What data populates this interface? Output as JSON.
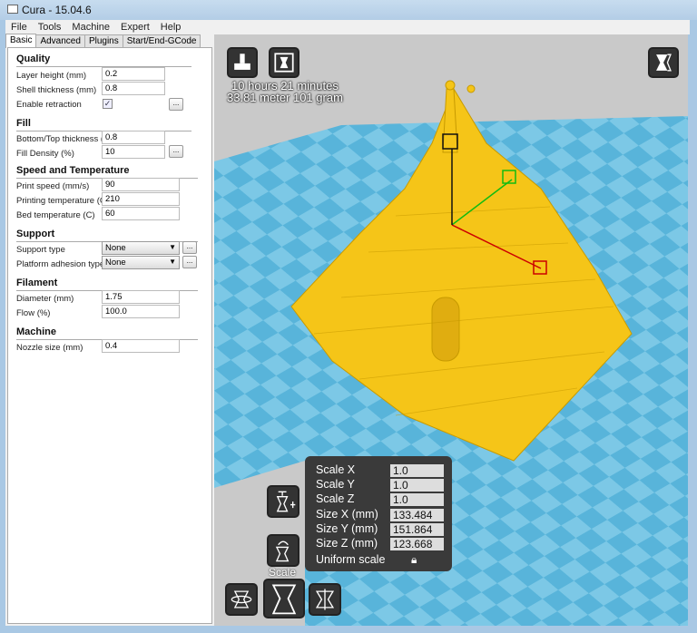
{
  "window": {
    "title": "Cura - 15.04.6"
  },
  "menu": [
    "File",
    "Tools",
    "Machine",
    "Expert",
    "Help"
  ],
  "tabs": [
    "Basic",
    "Advanced",
    "Plugins",
    "Start/End-GCode"
  ],
  "quality": {
    "title": "Quality",
    "layer_height_label": "Layer height (mm)",
    "layer_height": "0.2",
    "shell_label": "Shell thickness (mm)",
    "shell": "0.8",
    "retraction_label": "Enable retraction",
    "retraction_checked": true
  },
  "fill": {
    "title": "Fill",
    "bt_label": "Bottom/Top thickness (mm)",
    "bt": "0.8",
    "density_label": "Fill Density (%)",
    "density": "10"
  },
  "speed": {
    "title": "Speed and Temperature",
    "print_speed_label": "Print speed (mm/s)",
    "print_speed": "90",
    "print_temp_label": "Printing temperature (C)",
    "print_temp": "210",
    "bed_temp_label": "Bed temperature (C)",
    "bed_temp": "60"
  },
  "support": {
    "title": "Support",
    "type_label": "Support type",
    "type": "None",
    "adhesion_label": "Platform adhesion type",
    "adhesion": "None"
  },
  "filament": {
    "title": "Filament",
    "diameter_label": "Diameter (mm)",
    "diameter": "1.75",
    "flow_label": "Flow (%)",
    "flow": "100.0"
  },
  "machine": {
    "title": "Machine",
    "nozzle_label": "Nozzle size (mm)",
    "nozzle": "0.4"
  },
  "dots_label": "...",
  "print_info": {
    "time": "10 hours 21 minutes",
    "material": "33.81 meter 101 gram"
  },
  "scale_panel": {
    "scale_x_label": "Scale X",
    "scale_x": "1.0",
    "scale_y_label": "Scale Y",
    "scale_y": "1.0",
    "scale_z_label": "Scale Z",
    "scale_z": "1.0",
    "size_x_label": "Size X (mm)",
    "size_x": "133.484",
    "size_y_label": "Size Y (mm)",
    "size_y": "151.864",
    "size_z_label": "Size Z (mm)",
    "size_z": "123.668",
    "uniform_label": "Uniform scale"
  },
  "tool_label": "Scale",
  "colors": {
    "model": "#f5c518",
    "floor": "#5bb8dc",
    "panel": "#3a3a3a"
  }
}
